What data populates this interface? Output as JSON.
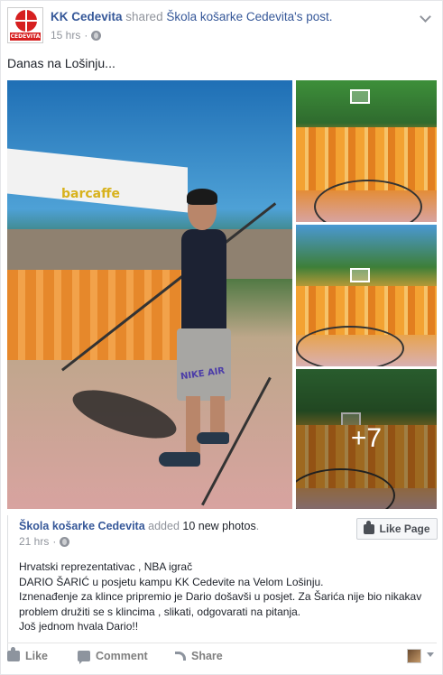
{
  "post": {
    "author": "KK Cedevita",
    "verb": "shared",
    "shared_page": "Škola košarke Cedevita's post.",
    "time": "15 hrs",
    "caption": "Danas na Lošinju...",
    "logo_text": "CEDEVITA"
  },
  "photos": {
    "main_banner_text": "barcaffe",
    "shorts_text": "NIKE AIR",
    "more_label": "+7"
  },
  "shared": {
    "page_name": "Škola košarke Cedevita",
    "added_text": "added",
    "count_text": "10 new photos",
    "time": "21 hrs",
    "like_page_label": "Like Page",
    "body_lines": [
      "Hrvatski reprezentativac , NBA igrač",
      "DARIO ŠARIĆ u posjetu kampu KK Cedevite na Velom Lošinju.",
      "Iznenađenje za klince pripremio je Dario došavši u posjet. Za Šarića nije bio nikakav",
      "problem družiti se s klincima , slikati, odgovarati na pitanja.",
      "Još jednom hvala Dario!!"
    ]
  },
  "actions": {
    "like": "Like",
    "comment": "Comment",
    "share": "Share"
  },
  "colors": {
    "link": "#365899",
    "muted": "#90949c",
    "text": "#1d2129"
  }
}
